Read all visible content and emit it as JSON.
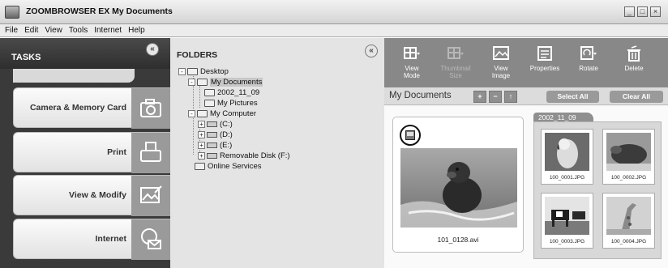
{
  "window": {
    "title": "ZOOMBROWSER EX  My Documents",
    "controls": [
      "minimize",
      "maximize",
      "close"
    ]
  },
  "menu": [
    "File",
    "Edit",
    "View",
    "Tools",
    "Internet",
    "Help"
  ],
  "tasks": {
    "title": "TASKS",
    "items": [
      {
        "label": "Camera & Memory Card",
        "icon": "camera-icon"
      },
      {
        "label": "Print",
        "icon": "printer-icon"
      },
      {
        "label": "View & Modify",
        "icon": "image-edit-icon"
      },
      {
        "label": "Internet",
        "icon": "internet-mail-icon"
      }
    ]
  },
  "folders": {
    "title": "FOLDERS",
    "tree": [
      {
        "label": "Desktop",
        "toggle": "-"
      },
      {
        "label": "My Documents",
        "toggle": "-",
        "selected": true
      },
      {
        "label": "2002_11_09"
      },
      {
        "label": "My Pictures"
      },
      {
        "label": "My Computer",
        "toggle": "-"
      },
      {
        "label": "(C:)",
        "toggle": "+"
      },
      {
        "label": "(D:)",
        "toggle": "+"
      },
      {
        "label": "(E:)",
        "toggle": "+"
      },
      {
        "label": "Removable Disk (F:)",
        "toggle": "+"
      },
      {
        "label": "Online Services"
      }
    ]
  },
  "toolbar": {
    "items": [
      {
        "label": "View\nMode",
        "icon": "view-mode-icon",
        "enabled": true
      },
      {
        "label": "Thumbnail\nSize",
        "icon": "thumbnail-size-icon",
        "enabled": false
      },
      {
        "label": "View\nImage",
        "icon": "view-image-icon",
        "enabled": true
      },
      {
        "label": "Properties",
        "icon": "properties-icon",
        "enabled": true
      },
      {
        "label": "Rotate",
        "icon": "rotate-icon",
        "enabled": true
      },
      {
        "label": "Delete",
        "icon": "delete-icon",
        "enabled": true
      }
    ]
  },
  "browser": {
    "path": "My Documents",
    "select_all": "Select All",
    "clear_all": "Clear All",
    "movie": {
      "file": "101_0128.avi"
    },
    "folder": {
      "name": "2002_11_09",
      "files": [
        "100_0001.JPG",
        "100_0002.JPG",
        "100_0003.JPG",
        "100_0004.JPG"
      ]
    }
  },
  "colors": {
    "tasks_bg": "#3a3a3a",
    "toolbar_bg": "#888888",
    "folders_bg": "#e4e4e4"
  }
}
